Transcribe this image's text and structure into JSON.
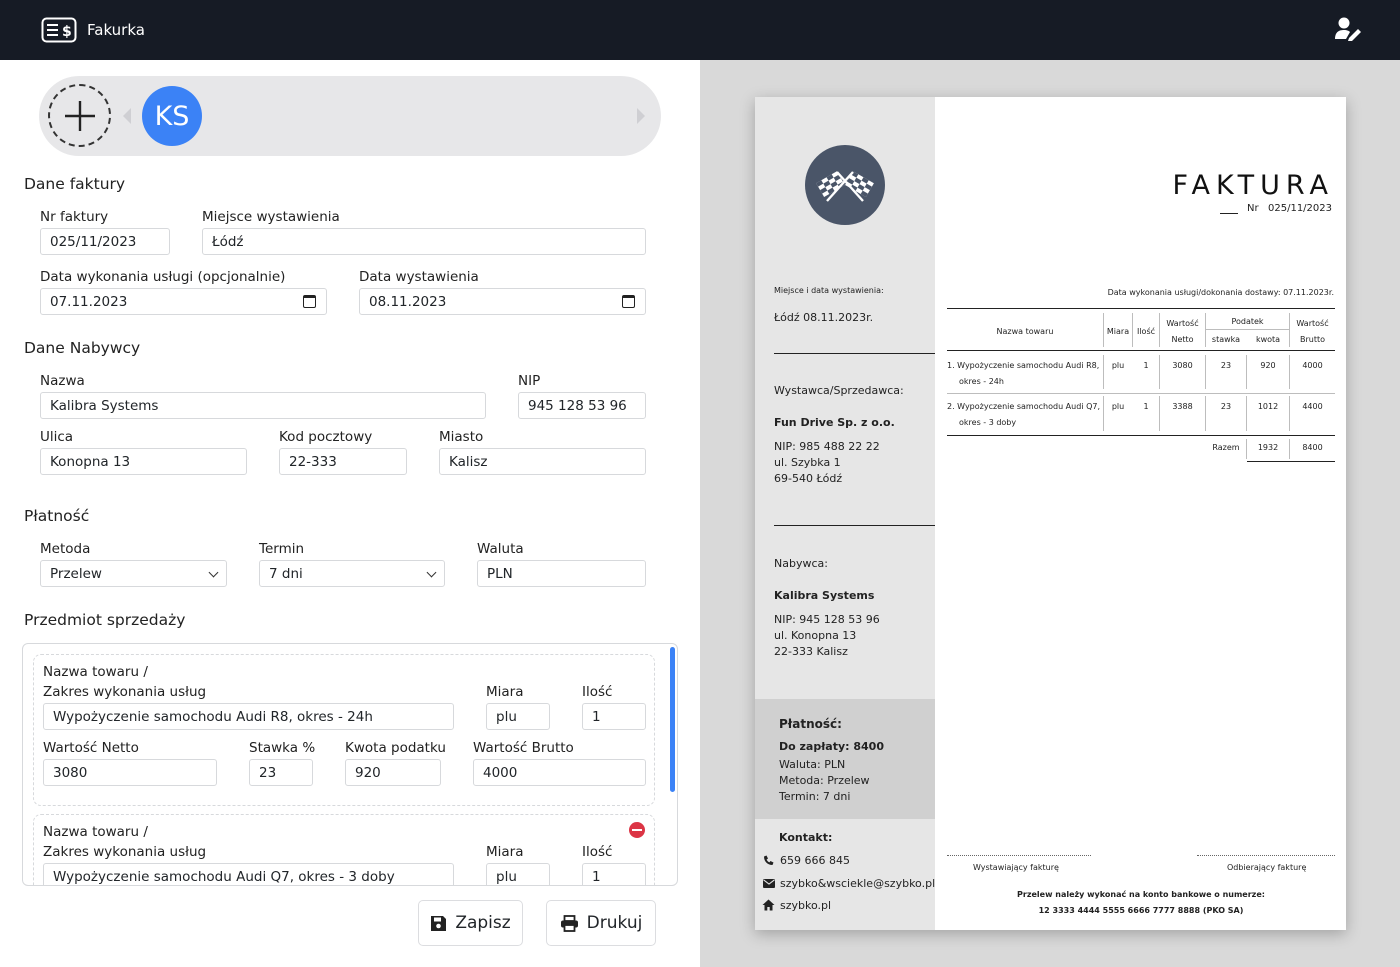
{
  "app": {
    "name": "Fakurka"
  },
  "clients": {
    "avatar_initials": "KS"
  },
  "invoice_section": {
    "title": "Dane faktury",
    "nr_label": "Nr faktury",
    "nr_value": "025/11/2023",
    "place_label": "Miejsce wystawienia",
    "place_value": "Łódź",
    "service_date_label": "Data wykonania usługi (opcjonalnie)",
    "service_date_value": "07.11.2023",
    "issue_date_label": "Data wystawienia",
    "issue_date_value": "08.11.2023"
  },
  "buyer_section": {
    "title": "Dane Nabywcy",
    "name_label": "Nazwa",
    "name_value": "Kalibra Systems",
    "nip_label": "NIP",
    "nip_value": "945 128 53 96",
    "street_label": "Ulica",
    "street_value": "Konopna 13",
    "zip_label": "Kod pocztowy",
    "zip_value": "22-333",
    "city_label": "Miasto",
    "city_value": "Kalisz"
  },
  "payment_section": {
    "title": "Płatność",
    "method_label": "Metoda",
    "method_value": "Przelew",
    "term_label": "Termin",
    "term_value": "7 dni",
    "currency_label": "Waluta",
    "currency_value": "PLN"
  },
  "items_section": {
    "title": "Przedmiot sprzedaży",
    "name_label_1": "Nazwa towaru /",
    "name_label_2": "Zakres wykonania usług",
    "unit_label": "Miara",
    "qty_label": "Ilość",
    "net_label": "Wartość Netto",
    "rate_label": "Stawka %",
    "tax_label": "Kwota podatku",
    "gross_label": "Wartość Brutto",
    "items": [
      {
        "name": "Wypożyczenie samochodu Audi R8, okres - 24h",
        "unit": "plu",
        "qty": "1",
        "net": "3080",
        "rate": "23",
        "tax": "920",
        "gross": "4000"
      },
      {
        "name": "Wypożyczenie samochodu Audi Q7, okres - 3 doby",
        "unit": "plu",
        "qty": "1"
      }
    ]
  },
  "actions": {
    "save_label": "Zapisz",
    "print_label": "Drukuj"
  },
  "preview": {
    "title": "FAKTURA",
    "nr_label": "Nr",
    "nr_value": "025/11/2023",
    "place_date_label": "Miejsce i data wystawienia:",
    "place_date_value": "Łódź 08.11.2023r.",
    "service_date_text": "Data wykonania usługi/dokonania dostawy: 07.11.2023r.",
    "seller_label": "Wystawca/Sprzedawca:",
    "seller_name": "Fun Drive Sp. z o.o.",
    "seller_nip": "NIP: 985 488 22 22",
    "seller_street": "ul. Szybka 1",
    "seller_city": "69-540 Łódź",
    "buyer_label": "Nabywca:",
    "buyer_name": "Kalibra Systems",
    "buyer_nip": "NIP: 945 128 53 96",
    "buyer_street": "ul. Konopna 13",
    "buyer_city": "22-333 Kalisz",
    "payment_title": "Płatność:",
    "payment_due": "Do zapłaty: 8400",
    "payment_currency": "Waluta: PLN",
    "payment_method": "Metoda: Przelew",
    "payment_term": "Termin: 7 dni",
    "contact_title": "Kontakt:",
    "contact_phone": "659 666 845",
    "contact_email": "szybko&wsciekle@szybko.pl",
    "contact_web": "szybko.pl",
    "table": {
      "h_name": "Nazwa towaru",
      "h_unit": "Miara",
      "h_qty": "Ilość",
      "h_net_1": "Wartość",
      "h_net_2": "Netto",
      "h_tax": "Podatek",
      "h_rate": "stawka",
      "h_amount": "kwota",
      "h_gross_1": "Wartość",
      "h_gross_2": "Brutto",
      "rows": [
        {
          "name_1": "1.  Wypożyczenie samochodu Audi R8,",
          "name_2": "okres - 24h",
          "unit": "plu",
          "qty": "1",
          "net": "3080",
          "rate": "23",
          "tax": "920",
          "gross": "4000"
        },
        {
          "name_1": "2.  Wypożyczenie samochodu Audi Q7,",
          "name_2": "okres - 3 doby",
          "unit": "plu",
          "qty": "1",
          "net": "3388",
          "rate": "23",
          "tax": "1012",
          "gross": "4400"
        }
      ],
      "sum_label": "Razem",
      "sum_tax": "1932",
      "sum_gross": "8400"
    },
    "sign_left": "Wystawiający fakturę",
    "sign_right": "Odbierający fakturę",
    "bank_line_1": "Przelew należy wykonać na konto bankowe o numerze:",
    "bank_line_2": "12 3333 4444 5555 6666 7777 8888 (PKO SA)"
  }
}
